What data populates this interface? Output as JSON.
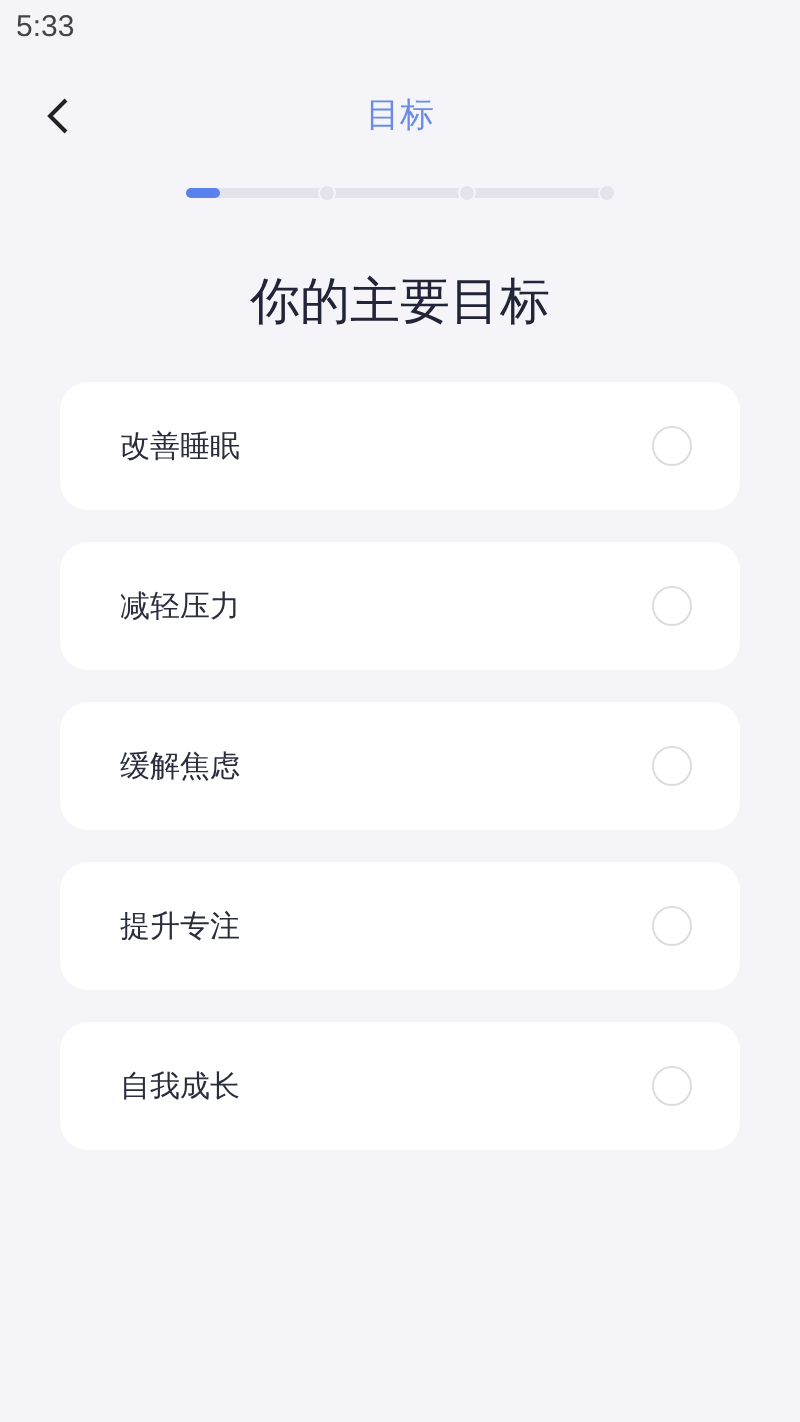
{
  "status_bar": {
    "time": "5:33"
  },
  "header": {
    "title": "目标"
  },
  "progress": {
    "level": 0.08
  },
  "heading": "你的主要目标",
  "options": [
    {
      "label": "改善睡眠",
      "selected": false
    },
    {
      "label": "减轻压力",
      "selected": false
    },
    {
      "label": "缓解焦虑",
      "selected": false
    },
    {
      "label": "提升专注",
      "selected": false
    },
    {
      "label": "自我成长",
      "selected": false
    }
  ]
}
